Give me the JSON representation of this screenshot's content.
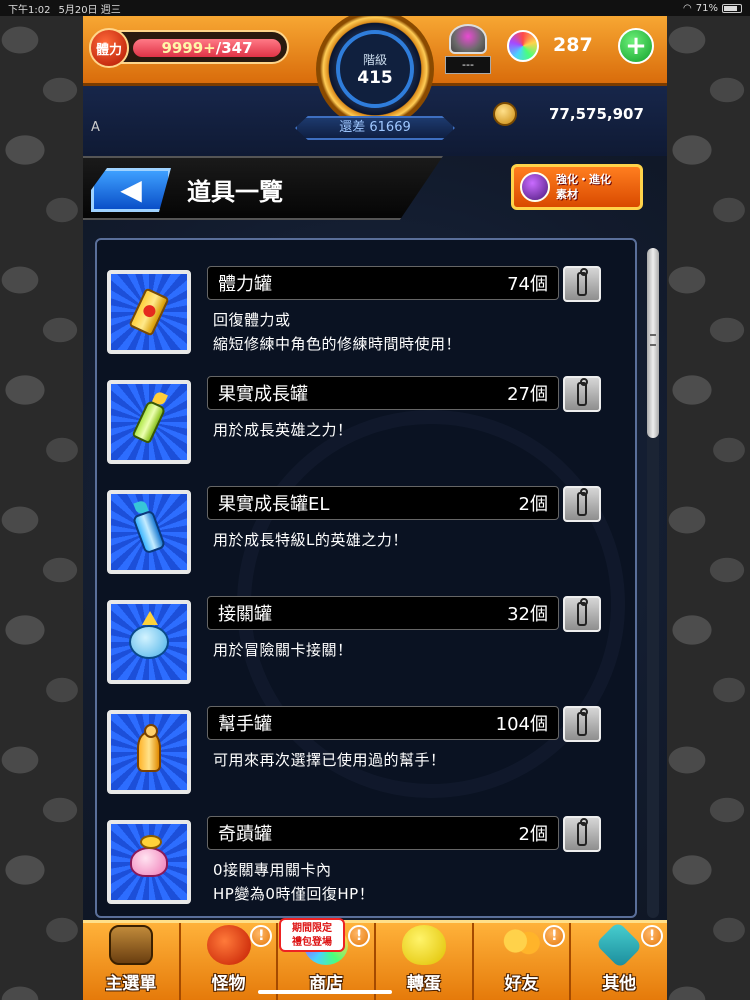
{
  "status_bar": {
    "time": "下午1:02",
    "date": "5月20日 週三",
    "battery": "71%"
  },
  "header": {
    "stamina_label": "體力",
    "stamina_current": "9999+",
    "stamina_separator": "/",
    "stamina_max": "347",
    "rank_label": "階級",
    "rank_value": "415",
    "rank_diff": "還差 61669",
    "friend_count": "---",
    "orb_count": "287",
    "add_orb_label": "+",
    "side_letter": "A",
    "coin_count": "77,575,907"
  },
  "title_bar": {
    "back_label": "◀",
    "title": "道具一覽",
    "material_button_line1": "強化・進化",
    "material_button_line2": "素材"
  },
  "items": [
    {
      "name": "體力罐",
      "count": "74個",
      "desc_lines": [
        "回復體力或",
        "縮短修練中角色的修練時間時使用！"
      ],
      "icon": "stamina-can-icon"
    },
    {
      "name": "果實成長罐",
      "count": "27個",
      "desc_lines": [
        "用於成長英雄之力！",
        ""
      ],
      "icon": "fruit-growth-bottle-icon"
    },
    {
      "name": "果實成長罐EL",
      "count": "2個",
      "desc_lines": [
        "用於成長特級L的英雄之力！",
        ""
      ],
      "icon": "fruit-growth-el-bottle-icon"
    },
    {
      "name": "接關罐",
      "count": "32個",
      "desc_lines": [
        "用於冒險關卡接關！",
        ""
      ],
      "icon": "continue-jar-icon"
    },
    {
      "name": "幫手罐",
      "count": "104個",
      "desc_lines": [
        "可用來再次選擇已使用過的幫手！",
        ""
      ],
      "icon": "helper-bottle-icon"
    },
    {
      "name": "奇蹟罐",
      "count": "2個",
      "desc_lines": [
        "0接關專用關卡內",
        "HP變為0時僅回復HP！"
      ],
      "icon": "miracle-jar-icon"
    }
  ],
  "bottom_nav": {
    "promo_badge_line1": "期間限定",
    "promo_badge_line2": "禮包登場",
    "alert_mark": "!",
    "items": [
      {
        "label": "主選單",
        "icon": "home-gate-icon"
      },
      {
        "label": "怪物",
        "icon": "monster-icon"
      },
      {
        "label": "商店",
        "icon": "shop-orb-icon"
      },
      {
        "label": "轉蛋",
        "icon": "gacha-egg-icon"
      },
      {
        "label": "好友",
        "icon": "friends-icon"
      },
      {
        "label": "其他",
        "icon": "other-menu-icon"
      }
    ]
  },
  "colors": {
    "header_orange": "#f7a733",
    "rank_blue": "#2f7ddb",
    "item_icon_blue": "#2d6dff",
    "nav_orange": "#ffb23a"
  }
}
